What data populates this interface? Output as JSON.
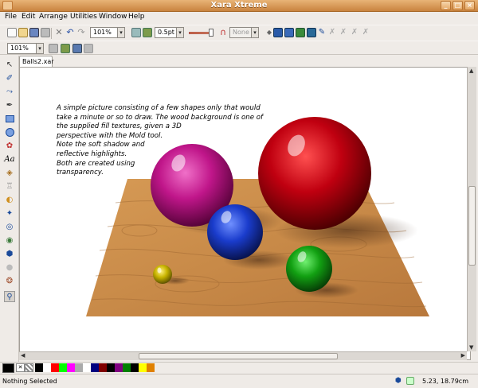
{
  "window": {
    "title": "Xara Xtreme"
  },
  "menu": [
    "File",
    "Edit",
    "Arrange",
    "Utilities",
    "Window",
    "Help"
  ],
  "toolbar": {
    "zoom": "101%",
    "line_width": "0.5pt",
    "arrowhead": "None",
    "zoom2": "101%"
  },
  "document": {
    "tab": "Balls2.xar",
    "text_lines": [
      "A simple picture consisting of a few shapes only that would",
      "take a minute or so to draw. The wood background is one of",
      "the supplied fill textures, given a 3D",
      "perspective with the Mold tool.",
      "Note the soft shadow and",
      "reflective highlights.",
      "Both are created using",
      "transparency."
    ]
  },
  "palette": [
    "#000000",
    "#ffffff",
    "#ff0000",
    "#00ff00",
    "#ff00ff",
    "#aaaaaa",
    "#ffffff",
    "#000080",
    "#800000",
    "#000000",
    "#800080",
    "#008000",
    "#000000",
    "#ffff00",
    "#e08000"
  ],
  "status": {
    "left": "Nothing Selected",
    "right": "5.23, 18.79cm"
  },
  "colors": {
    "title_bar": "#d28e4a",
    "wood": "#c88a48",
    "magenta_ball": "#c0168a",
    "red_ball": "#c00010",
    "blue_ball": "#1a3ccc",
    "green_ball": "#12a012",
    "yellow_ball": "#c8b400"
  }
}
